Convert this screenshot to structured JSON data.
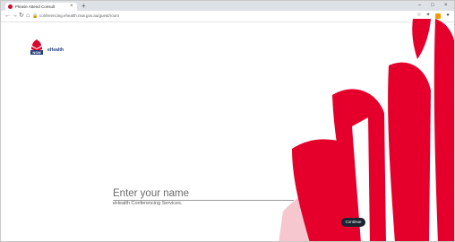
{
  "browser": {
    "tab_title": "Please Attend Consult",
    "tab_close": "×",
    "new_tab": "+",
    "minimize": "–",
    "maximize": "□",
    "close": "×",
    "url": "conferencing.ehealth.nsw.gov.au/guest/room",
    "back": "←",
    "forward": "→",
    "reload": "↻",
    "home": "⌂"
  },
  "brand": {
    "logo_text": "NSW",
    "wordmark": "eHealth",
    "primary_color": "#e4002b",
    "navy": "#1f3d7a"
  },
  "form": {
    "name_placeholder": "Enter your name",
    "name_value": "",
    "service_label": "eHealth Conferencing Services.",
    "continue_label": "Continue"
  }
}
